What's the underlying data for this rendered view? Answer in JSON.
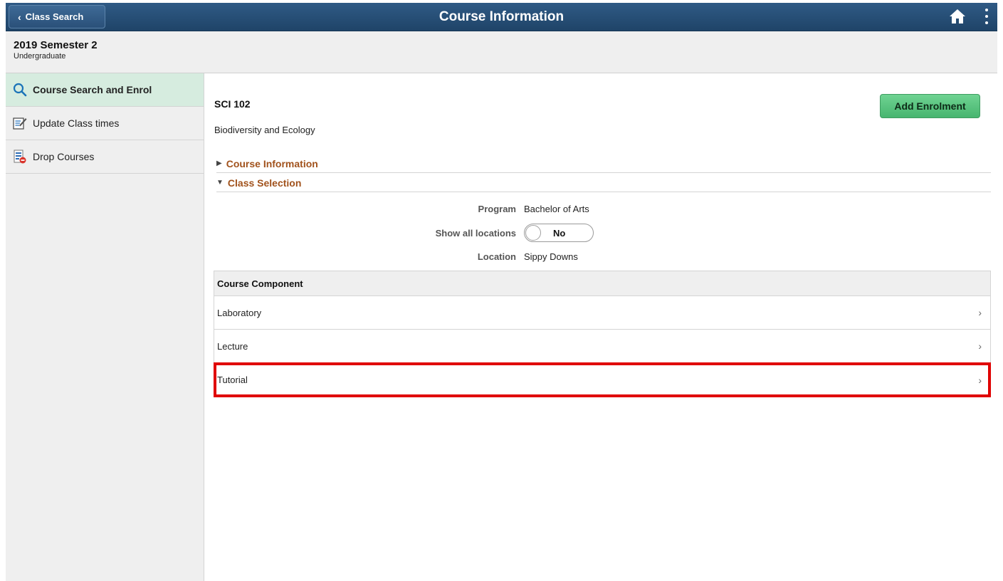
{
  "header": {
    "back_label": "Class Search",
    "title": "Course Information",
    "home_icon": "home-icon",
    "menu_icon": "kebab-menu-icon"
  },
  "term": {
    "title": "2019 Semester 2",
    "career": "Undergraduate"
  },
  "sidebar": {
    "items": [
      {
        "label": "Course Search and Enrol",
        "icon": "search-icon",
        "active": true
      },
      {
        "label": "Update Class times",
        "icon": "edit-document-icon",
        "active": false
      },
      {
        "label": "Drop Courses",
        "icon": "drop-list-icon",
        "active": false
      }
    ]
  },
  "course": {
    "code": "SCI 102",
    "title": "Biodiversity and Ecology",
    "add_button": "Add Enrolment"
  },
  "sections": {
    "course_information": "Course Information",
    "class_selection": "Class Selection"
  },
  "fields": {
    "program_label": "Program",
    "program_value": "Bachelor of Arts",
    "show_all_label": "Show all locations",
    "show_all_value": "No",
    "location_label": "Location",
    "location_value": "Sippy Downs"
  },
  "grid": {
    "header": "Course Component",
    "rows": [
      "Laboratory",
      "Lecture",
      "Tutorial"
    ],
    "highlighted_row": "Tutorial"
  },
  "colors": {
    "header_bar": "#2a5079",
    "accent_green": "#47b56f",
    "section_title": "#a1521c",
    "highlight": "#e00000"
  }
}
